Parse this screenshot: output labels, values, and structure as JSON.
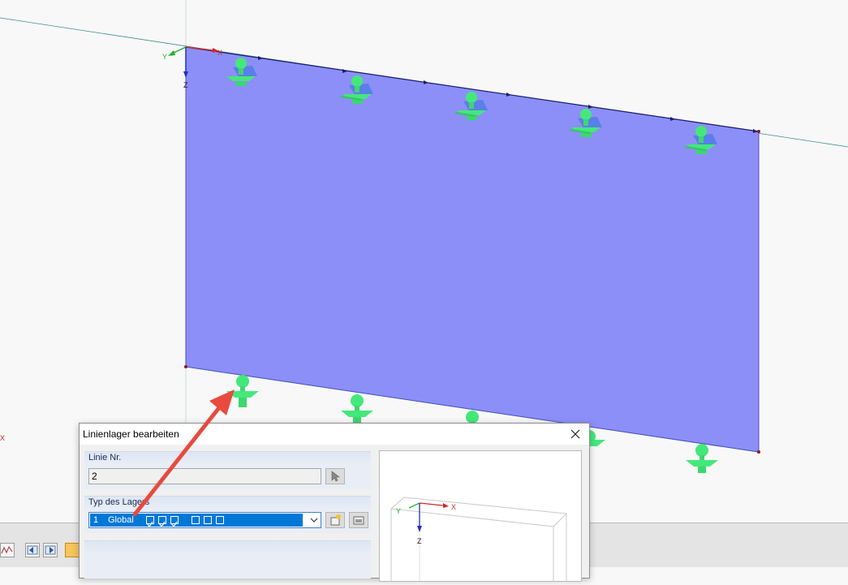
{
  "viewport": {
    "axes": {
      "x": "X",
      "y": "Y",
      "z": "Z"
    },
    "left_axis_label": "X",
    "surface_color": "#8c8ff8",
    "support_color": "#44e87a",
    "arrow_color": "#e84a3f"
  },
  "dialog": {
    "title": "Linienlager bearbeiten",
    "line_group": {
      "label": "Linie Nr.",
      "value": "2"
    },
    "support_group": {
      "label": "Typ des Lagers",
      "selected": {
        "number": "1",
        "name": "Global",
        "checked": [
          true,
          true,
          true,
          false,
          false,
          false
        ]
      }
    },
    "preview": {
      "axes": {
        "x": "X",
        "y": "Y",
        "z": "Z"
      }
    }
  },
  "icons": {
    "close": "close-icon",
    "pick": "pick-cursor-icon",
    "new": "new-item-icon",
    "edit": "edit-item-icon"
  }
}
